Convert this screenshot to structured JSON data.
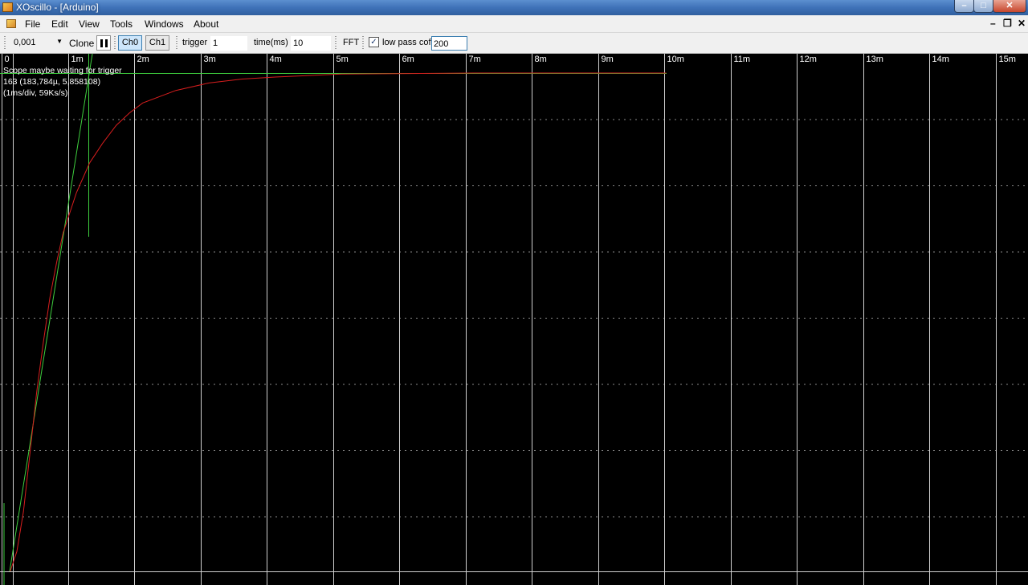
{
  "window": {
    "title": "XOscillo - [Arduino]",
    "controls": {
      "minimize": "–",
      "maximize": "□",
      "close": "✕"
    }
  },
  "menu": {
    "items": [
      "File",
      "Edit",
      "View",
      "Tools",
      "Windows",
      "About"
    ],
    "mdi_controls": {
      "minimize": "–",
      "restore": "❐",
      "close": "✕"
    }
  },
  "toolbar": {
    "scale_value": "0,001",
    "clone_label": "Clone",
    "ch0_label": "Ch0",
    "ch1_label": "Ch1",
    "trigger_label": "trigger",
    "trigger_value": "1",
    "time_label": "time(ms)",
    "time_value": "10",
    "fft_label": "FFT",
    "lowpass_checked": true,
    "lowpass_label": "low pass cof",
    "lowpass_value": "200"
  },
  "scope": {
    "x_tick_labels": [
      "0",
      "1m",
      "2m",
      "3m",
      "4m",
      "5m",
      "6m",
      "7m",
      "8m",
      "9m",
      "10m",
      "11m",
      "12m",
      "13m",
      "14m",
      "15m"
    ],
    "status_line": "Scope maybe waiting for trigger",
    "cursor_line": "163 (183,784µ, 5,858108)",
    "rate_line": "(1ms/div, 59Ks/s)",
    "colors": {
      "channel": "#d81e1e",
      "cursor": "#3ecf3e",
      "grid": "#cfcfcf",
      "grid_dotted": "#8a8a8a"
    }
  },
  "chart_data": {
    "type": "line",
    "title": "",
    "xlabel": "",
    "ylabel": "",
    "x_unit": "s",
    "xlim": [
      0,
      0.0155
    ],
    "grid": true,
    "series": [
      {
        "x": [
          0,
          0.0001,
          0.0002,
          0.0003,
          0.0004,
          0.0005,
          0.0006,
          0.0007,
          0.0008,
          0.0009,
          0.001,
          0.0012,
          0.0014,
          0.0016,
          0.0018,
          0.002,
          0.0025,
          0.003,
          0.0035,
          0.004,
          0.0045,
          0.005,
          0.006,
          0.007,
          0.008,
          0.009,
          0.0099
        ],
        "y": [
          0.0,
          0.04,
          0.12,
          0.24,
          0.36,
          0.46,
          0.55,
          0.62,
          0.68,
          0.72,
          0.76,
          0.82,
          0.86,
          0.895,
          0.92,
          0.94,
          0.965,
          0.98,
          0.988,
          0.992,
          0.995,
          0.998,
          0.999,
          1.0,
          1.0,
          1.0,
          1.0
        ]
      }
    ]
  }
}
